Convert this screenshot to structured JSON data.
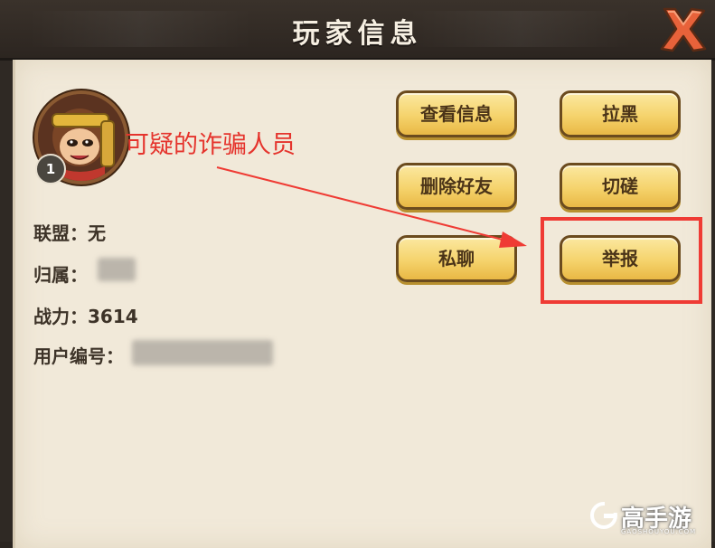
{
  "dialog": {
    "title": "玩家信息",
    "close_icon": "close-x-icon"
  },
  "player": {
    "level": "1",
    "alliance_label": "联盟：",
    "alliance_value": "无",
    "homeland_label": "归属：",
    "power_label": "战力：",
    "power_value": "3614",
    "user_id_label": "用户编号："
  },
  "annotation": {
    "text": "可疑的诈骗人员",
    "color": "#e5342d"
  },
  "buttons": {
    "view_info": "查看信息",
    "blacklist": "拉黑",
    "delete_friend": "删除好友",
    "spar": "切磋",
    "private_chat": "私聊",
    "report": "举报"
  },
  "watermark": {
    "text": "高手游",
    "url": "GAOSHOUYOU.COM"
  },
  "colors": {
    "button_fill": "#f5d36c",
    "button_border": "#6b4b1e",
    "panel_bg": "#f1e9d9",
    "highlight": "#ef3b34",
    "close_x": "#e8623a"
  }
}
